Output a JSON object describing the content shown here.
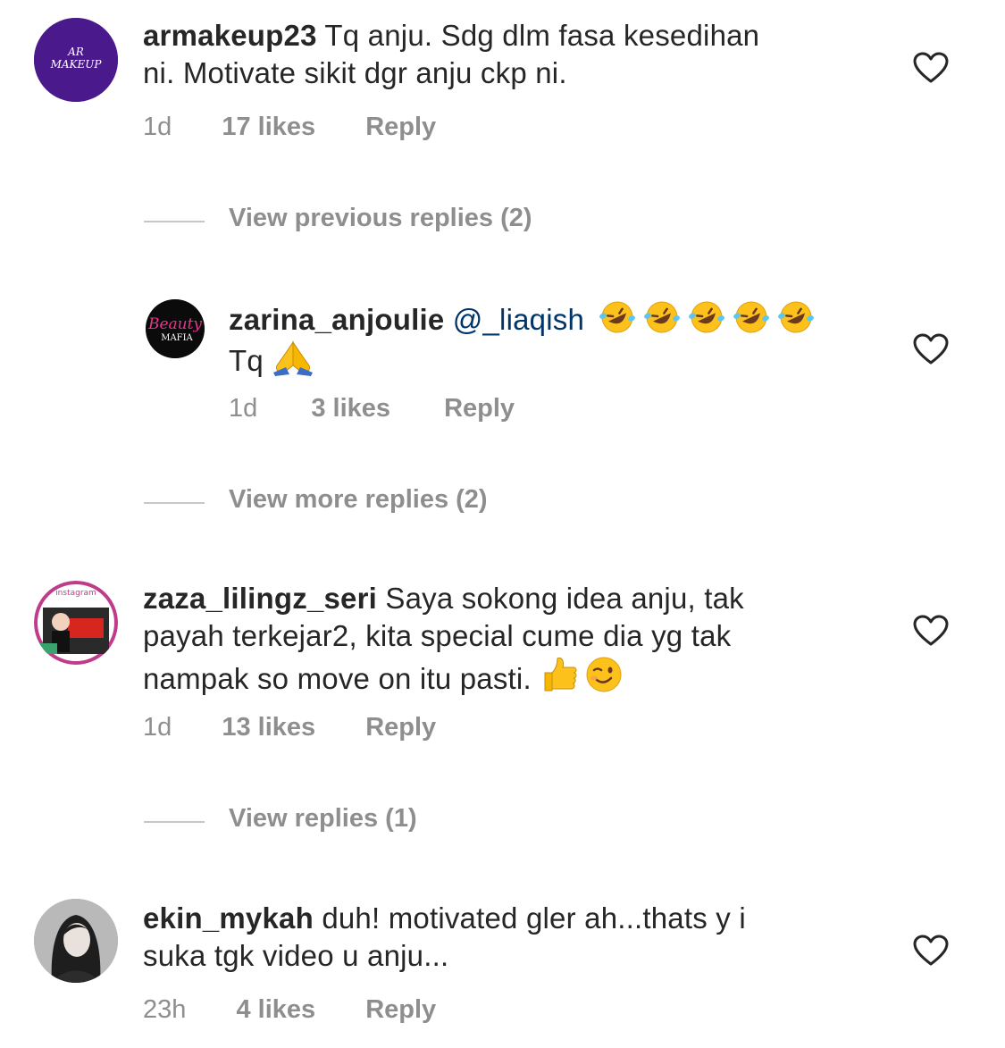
{
  "comments": [
    {
      "username": "armakeup23",
      "text_line1": " Tq anju. Sdg dlm fasa kesedihan",
      "text_line2": "ni. Motivate sikit dgr anju ckp ni.",
      "time": "1d",
      "likes": "17 likes",
      "reply_label": "Reply",
      "avatar_text_line1": "AR",
      "avatar_text_line2": "MAKEUP",
      "avatar_color": "#4a1a8c"
    },
    {
      "username": "zaza_lilingz_seri",
      "text_line1": " Saya sokong idea anju, tak",
      "text_line2": "payah terkejar2, kita special cume dia yg tak",
      "text_line3": "nampak so move on itu pasti. ",
      "emojis": [
        "thumbs-up",
        "wink"
      ],
      "time": "1d",
      "likes": "13 likes",
      "reply_label": "Reply",
      "avatar_label": "instagram"
    },
    {
      "username": "ekin_mykah",
      "text_line1": " duh! motivated gler ah...thats y i",
      "text_line2": "suka tgk video u anju...",
      "time": "23h",
      "likes": "4 likes",
      "reply_label": "Reply"
    }
  ],
  "reply": {
    "username": "zarina_anjoulie",
    "mention": " @_liaqish",
    "emojis": [
      "rofl",
      "rofl",
      "rofl",
      "rofl",
      "rofl"
    ],
    "text_line2": "Tq ",
    "emoji_line2": "folded-hands",
    "time": "1d",
    "likes": "3 likes",
    "reply_label": "Reply",
    "avatar_text_line1": "Beauty",
    "avatar_text_line2": "MAFIA"
  },
  "reply_toggles": {
    "previous": "View previous replies (2)",
    "more": "View more replies (2)",
    "replies": "View replies (1)"
  },
  "colors": {
    "text": "#262626",
    "meta": "#8e8e8e",
    "mention": "#003569",
    "divider": "#c7c7c7"
  }
}
